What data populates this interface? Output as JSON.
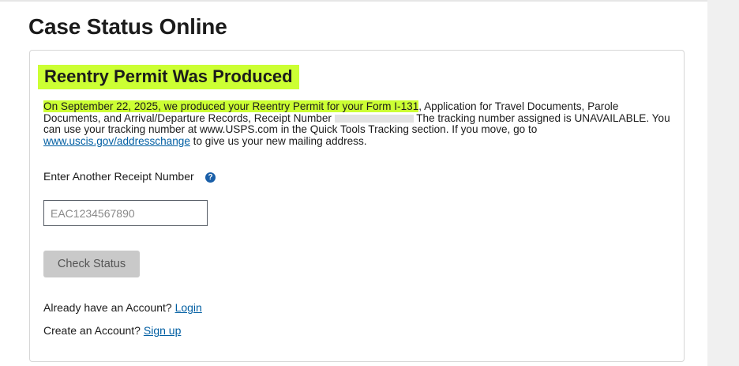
{
  "page": {
    "title": "Case Status Online"
  },
  "status": {
    "title": "Reentry Permit Was Produced",
    "highlight_text": "On September 22, 2025, we produced your Reentry Permit for your Form I-131",
    "text_part1": ", Application for Travel Documents, Parole Documents, and Arrival/Departure Records, Receipt Number ",
    "text_part2": " The tracking number assigned is UNAVAILABLE. You can use your tracking number at www.USPS.com in the Quick Tools Tracking section. If you move, go to ",
    "address_link": "www.uscis.gov/addresschange",
    "text_part3": " to give us your new mailing address."
  },
  "form": {
    "label": "Enter Another Receipt Number",
    "help_icon": "?",
    "placeholder": "EAC1234567890",
    "button": "Check Status"
  },
  "account": {
    "have_account": "Already have an Account? ",
    "login": "Login",
    "create": "Create an Account? ",
    "signup": "Sign up"
  },
  "colors": {
    "highlight": "#ccff33",
    "link": "#005ea2",
    "help_icon": "#1a5fa8"
  }
}
